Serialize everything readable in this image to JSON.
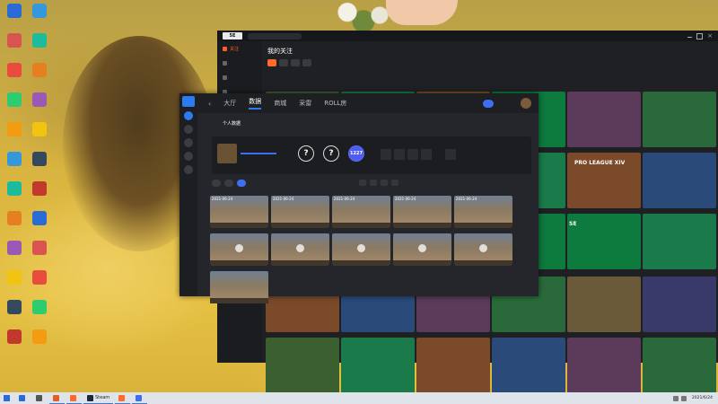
{
  "desktop": {
    "icons": [
      {
        "label": "",
        "color": "#2a6bd6"
      },
      {
        "label": "",
        "color": "#d9534f"
      },
      {
        "label": "",
        "color": "#e74c3c"
      },
      {
        "label": "",
        "color": "#2ecc71"
      },
      {
        "label": "",
        "color": "#f39c12"
      },
      {
        "label": "",
        "color": "#3498db"
      },
      {
        "label": "",
        "color": "#1abc9c"
      },
      {
        "label": "",
        "color": "#e67e22"
      },
      {
        "label": "",
        "color": "#9b59b6"
      },
      {
        "label": "",
        "color": "#f1c40f"
      },
      {
        "label": "",
        "color": "#34495e"
      },
      {
        "label": "",
        "color": "#c0392b"
      }
    ]
  },
  "mainwin": {
    "title": "我的关注",
    "search_placeholder": "",
    "nav": [
      {
        "label": "关注",
        "on": true
      },
      {
        "label": "",
        "on": false
      },
      {
        "label": "",
        "on": false
      },
      {
        "label": "",
        "on": false
      }
    ],
    "categories": [
      {
        "label": "",
        "on": true
      },
      {
        "label": "",
        "on": false
      },
      {
        "label": "",
        "on": false
      },
      {
        "label": "",
        "on": false
      }
    ],
    "banners": [
      "SE",
      "PRO LEAGUE XIV",
      "SE",
      "SE"
    ]
  },
  "overlay": {
    "tabs": [
      {
        "label": "大厅",
        "on": false
      },
      {
        "label": "数据",
        "on": true
      },
      {
        "label": "商城",
        "on": false
      },
      {
        "label": "采雷",
        "on": false
      },
      {
        "label": "ROLL房",
        "on": false
      }
    ],
    "top_button": "",
    "sub_tabs": [
      "",
      "个人数据"
    ],
    "profile": {
      "name": "",
      "stats": [
        "?",
        "?",
        "1227"
      ],
      "right_labels": [
        "",
        ""
      ]
    },
    "pills": [
      {
        "label": "",
        "on": false
      },
      {
        "label": "",
        "on": false
      },
      {
        "label": "",
        "on": true
      }
    ],
    "filters": [
      "",
      "",
      "",
      ""
    ],
    "clips": [
      {
        "date": "2021-06-24",
        "cap": ""
      },
      {
        "date": "2021-06-24",
        "cap": ""
      },
      {
        "date": "2021-06-24",
        "cap": ""
      },
      {
        "date": "2021-06-24",
        "cap": ""
      },
      {
        "date": "2021-06-24",
        "cap": ""
      },
      {
        "date": "",
        "cap": ""
      },
      {
        "date": "",
        "cap": ""
      },
      {
        "date": "",
        "cap": ""
      },
      {
        "date": "",
        "cap": ""
      },
      {
        "date": "",
        "cap": ""
      },
      {
        "date": "",
        "cap": ""
      }
    ]
  },
  "taskbar": {
    "items": [
      {
        "label": "",
        "color": "#2a6bd6",
        "open": false
      },
      {
        "label": "",
        "color": "#555",
        "open": false
      },
      {
        "label": "",
        "color": "#e25d2b",
        "open": true
      },
      {
        "label": "",
        "color": "#ff6a2b",
        "open": true
      },
      {
        "label": "Steam",
        "color": "#1b2838",
        "open": true
      },
      {
        "label": "",
        "color": "#ff6a2b",
        "open": true
      },
      {
        "label": "",
        "color": "#3d6ff0",
        "open": true
      }
    ],
    "clock_time": "",
    "clock_date": "2021/6/24"
  }
}
